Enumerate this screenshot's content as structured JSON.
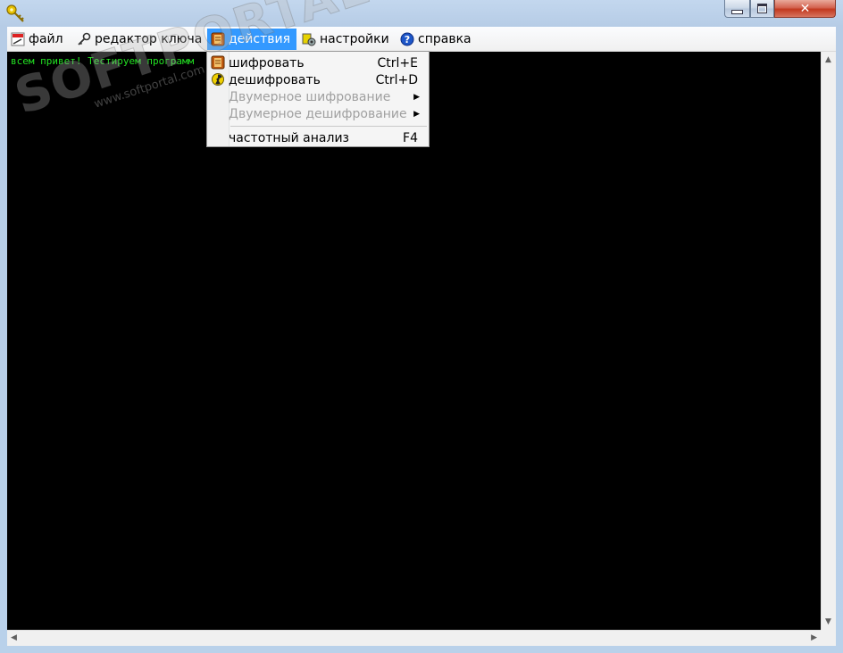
{
  "window": {
    "icon": "key-icon",
    "controls": {
      "minimize": "minimize-icon",
      "maximize": "maximize-icon",
      "close": "close-icon"
    }
  },
  "menubar": {
    "items": [
      {
        "label": "файл",
        "icon": "file-icon"
      },
      {
        "label": "редактор ключа",
        "icon": "key-edit-icon"
      },
      {
        "label": "действия",
        "icon": "actions-icon",
        "active": true
      },
      {
        "label": "настройки",
        "icon": "settings-icon"
      },
      {
        "label": "справка",
        "icon": "help-icon"
      }
    ]
  },
  "console": {
    "text": "всем привет! Тестируем программ"
  },
  "dropdown": {
    "items": [
      {
        "label": "шифровать",
        "shortcut": "Ctrl+E",
        "icon": "encrypt-icon",
        "enabled": true
      },
      {
        "label": "дешифровать",
        "shortcut": "Ctrl+D",
        "icon": "decrypt-icon",
        "enabled": true
      },
      {
        "label": "Двумерное шифрование",
        "submenu": true,
        "enabled": false
      },
      {
        "label": "Двумерное дешифрование",
        "submenu": true,
        "enabled": false
      },
      {
        "label": "частотный анализ",
        "shortcut": "F4",
        "enabled": true
      }
    ]
  },
  "watermark": {
    "brand": "SOFTPORTAL",
    "url": "www.softportal.com"
  },
  "colors": {
    "console_bg": "#000000",
    "console_text": "#22e022",
    "menu_highlight": "#3399ff"
  }
}
